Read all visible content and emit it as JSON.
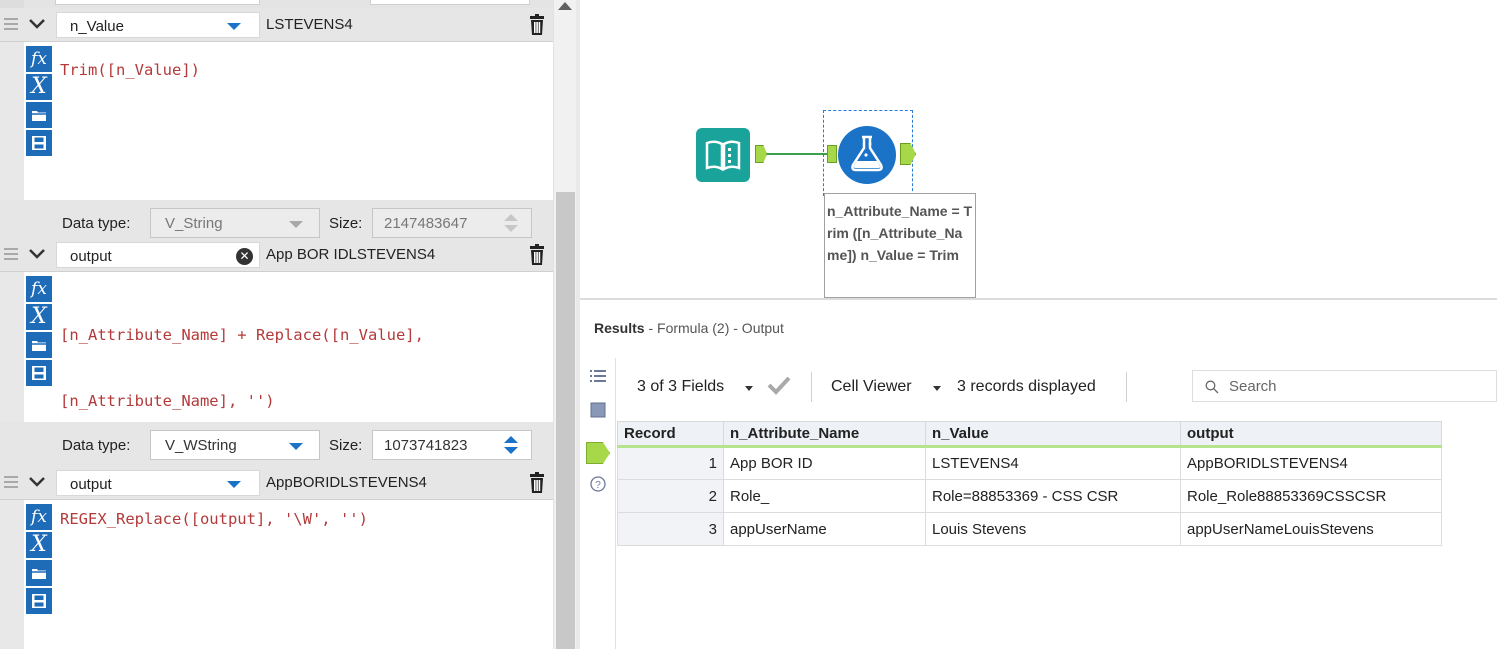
{
  "formulas": [
    {
      "field": "n_Value",
      "preview": "LSTEVENS4",
      "expression": "Trim([n_Value])",
      "data_type": "V_String",
      "size_label": "Size:",
      "size": "2147483647"
    },
    {
      "field": "output",
      "preview": "App BOR IDLSTEVENS4",
      "expression_line1": "[n_Attribute_Name] + Replace([n_Value],",
      "expression_line2": "[n_Attribute_Name], '')",
      "data_type": "V_WString",
      "size_label": "Size:",
      "size": "1073741823"
    },
    {
      "field": "output",
      "preview": "AppBORIDLSTEVENS4",
      "expression": "REGEX_Replace([output], '\\W', '')"
    }
  ],
  "labels": {
    "data_type": "Data type:"
  },
  "canvas": {
    "annotation": "n_Attribute_Name = Trim ([n_Attribute_Name]) n_Value = Trim"
  },
  "results": {
    "title_bold": "Results",
    "title_rest": " - Formula (2) - Output",
    "fields_label": "3 of 3 Fields",
    "cell_viewer": "Cell Viewer",
    "records_displayed": "3 records displayed",
    "search_placeholder": "Search",
    "columns": [
      "Record",
      "n_Attribute_Name",
      "n_Value",
      "output"
    ],
    "rows": [
      [
        "1",
        "App BOR ID",
        "LSTEVENS4",
        "AppBORIDLSTEVENS4"
      ],
      [
        "2",
        "Role_",
        "Role=88853369 - CSS CSR",
        "Role_Role88853369CSSCSR"
      ],
      [
        "3",
        "appUserName",
        "Louis Stevens",
        "appUserNameLouisStevens"
      ]
    ]
  },
  "colors": {
    "tool_blue": "#1a73c7",
    "input_teal": "#1aa39a",
    "anchor_green": "#a6d84a"
  }
}
